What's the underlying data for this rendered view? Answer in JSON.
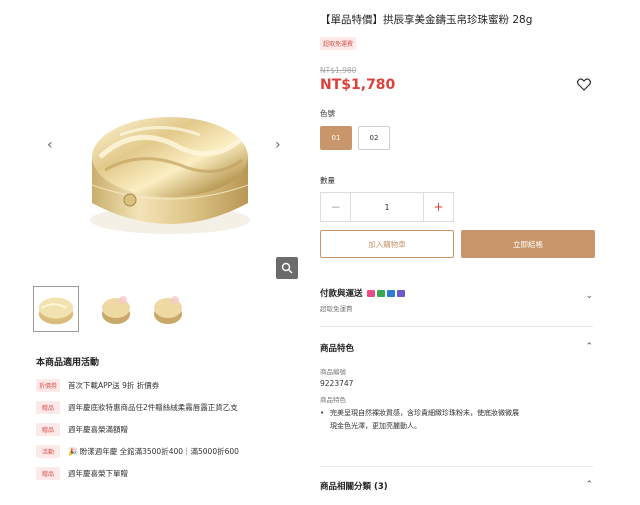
{
  "gallery": {
    "prev_icon": "chevron-left-icon",
    "next_icon": "chevron-right-icon",
    "zoom_icon": "magnifier-icon",
    "prev_glyph": "‹",
    "next_glyph": "›"
  },
  "product": {
    "title": "【單品特價】拱辰享美金鑄玉帛珍珠蜜粉 28g",
    "ship_badge": "超取免運費",
    "old_price": "NT$1,980",
    "new_price": "NT$1,780",
    "color_label": "色號",
    "colors": [
      "01",
      "02"
    ],
    "qty_label": "數量",
    "qty_minus": "−",
    "qty_value": "1",
    "qty_plus": "+",
    "add_to_cart": "加入購物車",
    "buy_now": "立即結帳"
  },
  "sections": {
    "payment": {
      "title": "付款與運送",
      "sub": "超取免運費",
      "chevron": "⌄"
    },
    "features": {
      "title": "商品特色",
      "chevron": "⌃",
      "code_label": "商品編號",
      "code_value": "9223747",
      "feature_label": "商品特色",
      "bullet": "•",
      "feature_line1": "完美呈現自然裸妝質感，含珍貴細緻珍珠粉末，使底妝微微展",
      "feature_line2": "現金色光澤，更加亮麗動人。"
    },
    "category": {
      "title": "商品相關分類 (3)",
      "chevron": "⌃"
    }
  },
  "activities": {
    "title": "本商品適用活動",
    "items": [
      {
        "badge": "折價券",
        "text": "首次下載APP送 9折 折價券"
      },
      {
        "badge": "贈品",
        "text": "週年慶底妝特惠商品任2件贈絲絨柔霧唇露正貨乙支"
      },
      {
        "badge": "贈品",
        "text": "週年慶喜榮滿額贈"
      },
      {
        "badge": "活動",
        "text": "🎉 盼漾週年慶 全館滿3500折400｜滿5000折600"
      },
      {
        "badge": "贈品",
        "text": "週年慶喜榮下單贈"
      }
    ]
  },
  "colors": {
    "accent": "#c8966a",
    "price_red": "#e0403a",
    "badge_bg": "#fde9e7"
  }
}
